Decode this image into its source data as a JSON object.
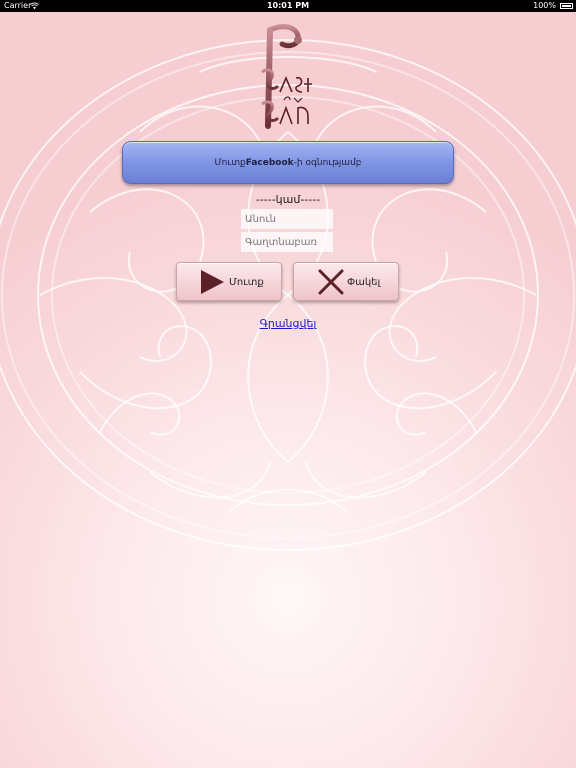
{
  "status_bar": {
    "carrier": "Carrier",
    "time": "10:01 PM",
    "battery": "100%"
  },
  "icons": {
    "wifi": "wifi-icon",
    "battery": "battery-icon",
    "login": "play-triangle-icon",
    "close": "x-close-icon"
  },
  "login_form": {
    "facebook_button": {
      "prefix": "Մուտք ",
      "brand": "Facebook",
      "suffix": "-ի օգնությամբ"
    },
    "or_divider": "-----կամ-----",
    "username_placeholder": "Անուն",
    "password_placeholder": "Գաղտնաբառ",
    "login_label": "Մուտք",
    "close_label": "Փակել",
    "register_link": "Գրանցվել"
  },
  "colors": {
    "facebook_button": "#8297e6",
    "action_button": "#f5d3d8",
    "icon_dark": "#5b2127",
    "link": "#1a1acc",
    "background": "#f9d9dc"
  }
}
